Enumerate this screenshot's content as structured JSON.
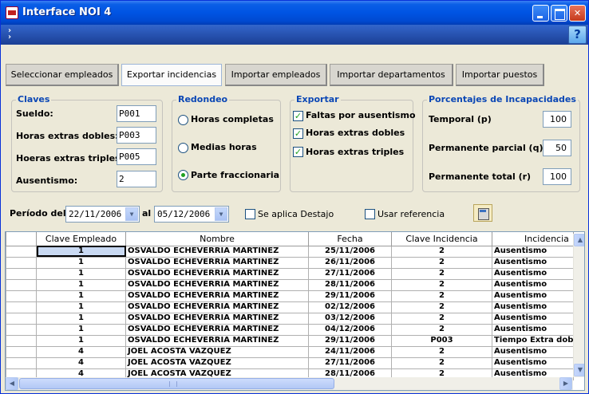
{
  "window": {
    "title": "Interface NOI 4"
  },
  "toolbar": {
    "overflow_glyph": "»",
    "help_label": "?"
  },
  "tabs": [
    {
      "label": "Seleccionar empleados"
    },
    {
      "label": "Exportar incidencias"
    },
    {
      "label": "Importar empleados"
    },
    {
      "label": "Importar departamentos"
    },
    {
      "label": "Importar puestos"
    }
  ],
  "claves": {
    "title": "Claves",
    "sueldo_label": "Sueldo:",
    "sueldo_value": "P001",
    "dobles_label": "Horas extras dobles:",
    "dobles_value": "P003",
    "triples_label": "Hoeras extras triples:",
    "triples_value": "P005",
    "ausentismo_label": "Ausentismo:",
    "ausentismo_value": "2"
  },
  "redondeo": {
    "title": "Redondeo",
    "options": [
      "Horas completas",
      "Medias horas",
      "Parte fraccionaria"
    ],
    "selected": 2
  },
  "exportar": {
    "title": "Exportar",
    "options": [
      "Faltas por ausentismo",
      "Horas extras dobles",
      "Horas extras triples"
    ],
    "checked": [
      true,
      true,
      true
    ]
  },
  "porcentajes": {
    "title": "Porcentajes de Incapacidades",
    "temporal_label": "Temporal (p)",
    "temporal_value": "100",
    "parcial_label": "Permanente parcial (q)",
    "parcial_value": "50",
    "total_label": "Permanente total (r)",
    "total_value": "100"
  },
  "periodo": {
    "label": "Período del",
    "from": "22/11/2006",
    "to_label": "al",
    "to": "05/12/2006",
    "destajo_label": "Se aplica Destajo",
    "destajo_checked": false,
    "referencia_label": "Usar referencia",
    "referencia_checked": false
  },
  "grid": {
    "headers": [
      "Clave Empleado",
      "Nombre",
      "Fecha",
      "Clave Incidencia",
      "Incidencia"
    ],
    "rows": [
      [
        "1",
        "OSVALDO ECHEVERRIA MARTINEZ",
        "25/11/2006",
        "2",
        "Ausentismo"
      ],
      [
        "1",
        "OSVALDO ECHEVERRIA MARTINEZ",
        "26/11/2006",
        "2",
        "Ausentismo"
      ],
      [
        "1",
        "OSVALDO ECHEVERRIA MARTINEZ",
        "27/11/2006",
        "2",
        "Ausentismo"
      ],
      [
        "1",
        "OSVALDO ECHEVERRIA MARTINEZ",
        "28/11/2006",
        "2",
        "Ausentismo"
      ],
      [
        "1",
        "OSVALDO ECHEVERRIA MARTINEZ",
        "29/11/2006",
        "2",
        "Ausentismo"
      ],
      [
        "1",
        "OSVALDO ECHEVERRIA MARTINEZ",
        "02/12/2006",
        "2",
        "Ausentismo"
      ],
      [
        "1",
        "OSVALDO ECHEVERRIA MARTINEZ",
        "03/12/2006",
        "2",
        "Ausentismo"
      ],
      [
        "1",
        "OSVALDO ECHEVERRIA MARTINEZ",
        "04/12/2006",
        "2",
        "Ausentismo"
      ],
      [
        "1",
        "OSVALDO ECHEVERRIA MARTINEZ",
        "29/11/2006",
        "P003",
        "Tiempo Extra dobl"
      ],
      [
        "4",
        "JOEL ACOSTA VAZQUEZ",
        "24/11/2006",
        "2",
        "Ausentismo"
      ],
      [
        "4",
        "JOEL ACOSTA VAZQUEZ",
        "27/11/2006",
        "2",
        "Ausentismo"
      ],
      [
        "4",
        "JOEL ACOSTA VAZQUEZ",
        "28/11/2006",
        "2",
        "Ausentismo"
      ]
    ]
  }
}
